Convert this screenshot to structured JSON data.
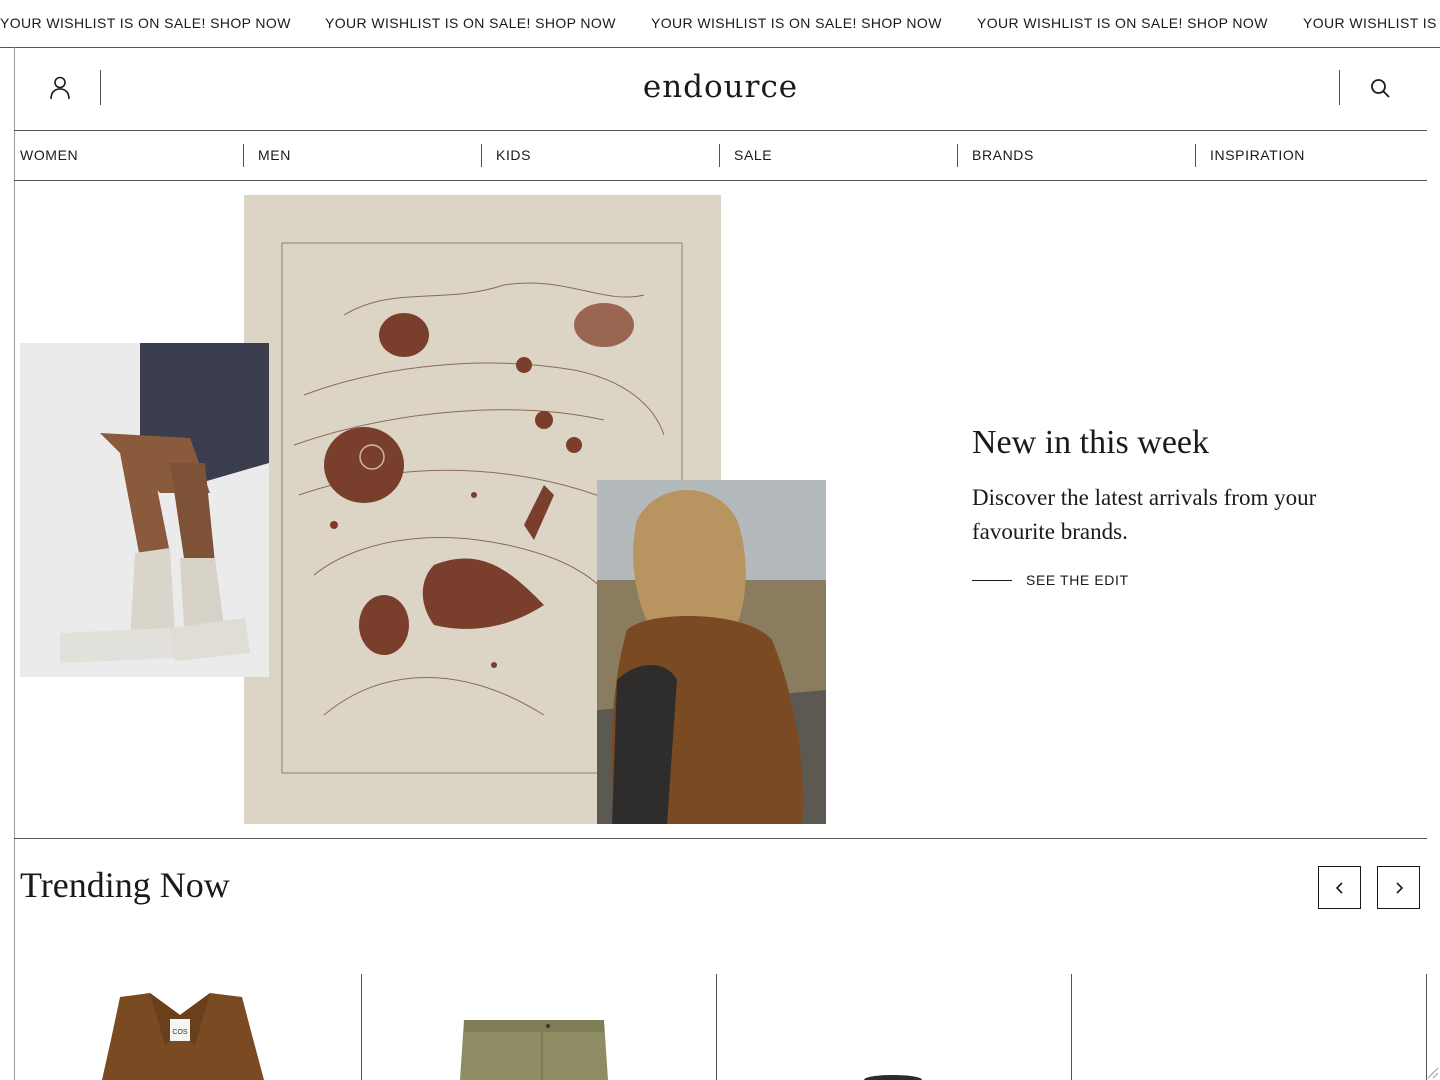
{
  "ticker": {
    "items": [
      "YOUR WISHLIST IS ON SALE! SHOP NOW",
      "YOUR WISHLIST IS ON SALE! SHOP NOW",
      "YOUR WISHLIST IS ON SALE! SHOP NOW",
      "YOUR WISHLIST IS ON SALE! SHOP NOW",
      "YOUR WISHLIST IS ON SALE! SHOP NOW"
    ]
  },
  "header": {
    "logo": "endource",
    "account_icon": "user-icon",
    "search_icon": "search-icon"
  },
  "nav": {
    "items": [
      "WOMEN",
      "MEN",
      "KIDS",
      "SALE",
      "BRANDS",
      "INSPIRATION"
    ]
  },
  "hero": {
    "title": "New in this week",
    "subtitle": "Discover the latest arrivals from your favourite brands.",
    "cta": "SEE THE EDIT"
  },
  "trending": {
    "title": "Trending Now",
    "prev_icon": "chevron-left-icon",
    "next_icon": "chevron-right-icon",
    "products": [
      {
        "brand_tag": "COS"
      },
      {},
      {},
      {}
    ]
  },
  "colors": {
    "text": "#1a1a1a",
    "line": "#555555",
    "art_paper": "#dcd5c6",
    "art_ink": "#7a3f2c",
    "coat": "#7a4a22",
    "trousers": "#8d8c63"
  }
}
